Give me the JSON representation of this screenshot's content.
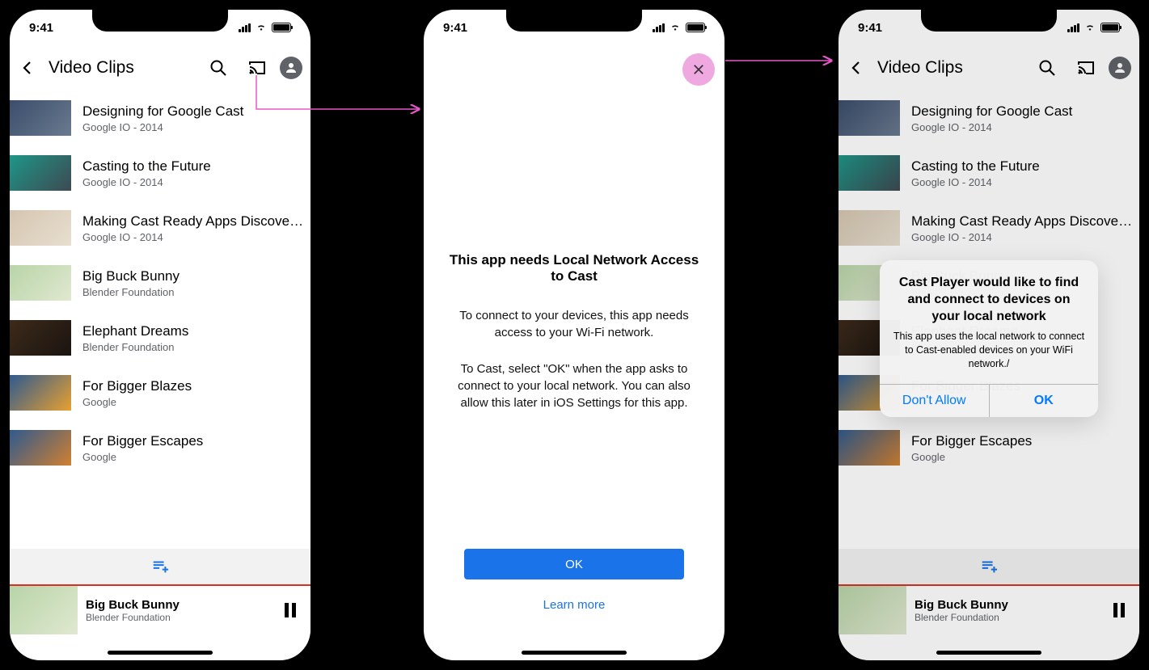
{
  "status": {
    "time": "9:41"
  },
  "header": {
    "title": "Video Clips",
    "icons": {
      "back": "back-chevron",
      "search": "search",
      "cast": "cast",
      "account": "account-avatar"
    }
  },
  "videos": [
    {
      "title": "Designing for Google Cast",
      "subtitle": "Google IO - 2014",
      "thumb": "t1"
    },
    {
      "title": "Casting to the Future",
      "subtitle": "Google IO - 2014",
      "thumb": "t2"
    },
    {
      "title": "Making Cast Ready Apps Discoverable",
      "subtitle": "Google IO - 2014",
      "thumb": "t3"
    },
    {
      "title": "Big Buck Bunny",
      "subtitle": "Blender Foundation",
      "thumb": "t4"
    },
    {
      "title": "Elephant Dreams",
      "subtitle": "Blender Foundation",
      "thumb": "t5"
    },
    {
      "title": "For Bigger Blazes",
      "subtitle": "Google",
      "thumb": "t6"
    },
    {
      "title": "For Bigger Escapes",
      "subtitle": "Google",
      "thumb": "t7"
    }
  ],
  "nowPlaying": {
    "title": "Big Buck Bunny",
    "subtitle": "Blender Foundation"
  },
  "infoSheet": {
    "title": "This app needs Local Network Access to Cast",
    "para1": "To connect to your devices, this app needs access to your Wi-Fi network.",
    "para2": "To Cast, select \"OK\" when the app asks to connect to your local network. You can also allow this later in iOS Settings for this app.",
    "okLabel": "OK",
    "learnMore": "Learn more"
  },
  "systemAlert": {
    "title": "Cast Player would like to find and connect to devices on your local network",
    "message": "This app uses the local network to connect to Cast-enabled devices on your WiFi network./",
    "deny": "Don't Allow",
    "allow": "OK"
  }
}
